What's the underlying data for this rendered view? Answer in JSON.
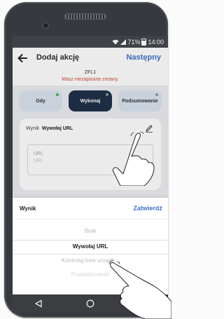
{
  "status_bar": {
    "battery_text": "71%",
    "time": "14:00"
  },
  "app_bar": {
    "title": "Dodaj akcję",
    "next_label": "Następny"
  },
  "config_name": "ZFL1",
  "unsaved_notice": "Masz niezapisane zmiany.",
  "tabs": [
    {
      "label": "Gdy",
      "dot_color": "#2fbf4b",
      "active": false
    },
    {
      "label": "Wykonaj",
      "dot_color": "#8a96a6",
      "active": true
    },
    {
      "label": "Podsumowanie",
      "dot_color": "#8a96a6",
      "active": false
    }
  ],
  "action_card": {
    "result_label": "Wynik",
    "result_value": "Wywołaj URL",
    "url_label": "URL",
    "url_placeholder": "URL"
  },
  "sheet": {
    "title": "Wynik",
    "confirm_label": "Zatwierdź",
    "options": [
      "Brak",
      "Wywołaj URL",
      "Kontroluj inne urządz...",
      "Powiadomienie"
    ],
    "selected_option": "Wywołaj URL"
  },
  "colors": {
    "accent": "#3f73c9",
    "active_tab": "#20324a",
    "warning_text": "#d24a3a"
  }
}
